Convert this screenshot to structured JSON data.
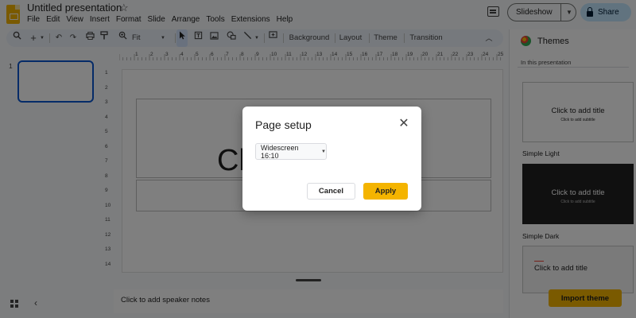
{
  "app": {
    "doc_title": "Untitled presentation",
    "menu": [
      "File",
      "Edit",
      "View",
      "Insert",
      "Format",
      "Slide",
      "Arrange",
      "Tools",
      "Extensions",
      "Help"
    ],
    "slideshow_label": "Slideshow",
    "share_label": "Share"
  },
  "toolbar": {
    "zoom_label": "Fit",
    "background_label": "Background",
    "layout_label": "Layout",
    "theme_label": "Theme",
    "transition_label": "Transition"
  },
  "filmstrip": {
    "slide_number": "1"
  },
  "ruler": {
    "h_ticks": [
      "1",
      "2",
      "3",
      "4",
      "5",
      "6",
      "7",
      "8",
      "9",
      "10",
      "11",
      "12",
      "13",
      "14",
      "15",
      "16",
      "17",
      "18",
      "19",
      "20",
      "21",
      "22",
      "23",
      "24",
      "25"
    ],
    "v_ticks": [
      "1",
      "2",
      "3",
      "4",
      "5",
      "6",
      "7",
      "8",
      "9",
      "10",
      "11",
      "12",
      "13",
      "14"
    ]
  },
  "slide": {
    "title_text": "Cl"
  },
  "notes": {
    "placeholder": "Click to add speaker notes"
  },
  "themes": {
    "header": "Themes",
    "section_label": "In this presentation",
    "cards": [
      {
        "name": "Simple Light",
        "title": "Click to add title",
        "subtitle": "Click to add subtitle",
        "bg": "#ffffff",
        "fg": "#1f1f1f"
      },
      {
        "name": "Simple Dark",
        "title": "Click to add title",
        "subtitle": "Click to add subtitle",
        "bg": "#212121",
        "fg": "#ffffff"
      },
      {
        "name": "",
        "title": "Click to add title",
        "subtitle": "",
        "bg": "#f5f5f5",
        "fg": "#1f1f1f"
      }
    ],
    "import_label": "Import theme"
  },
  "dialog": {
    "title": "Page setup",
    "size_value": "Widescreen 16:10",
    "cancel_label": "Cancel",
    "apply_label": "Apply"
  },
  "colors": {
    "accent": "#f4b400",
    "selection": "#0b57d0",
    "share_bg": "#c2e7ff"
  }
}
